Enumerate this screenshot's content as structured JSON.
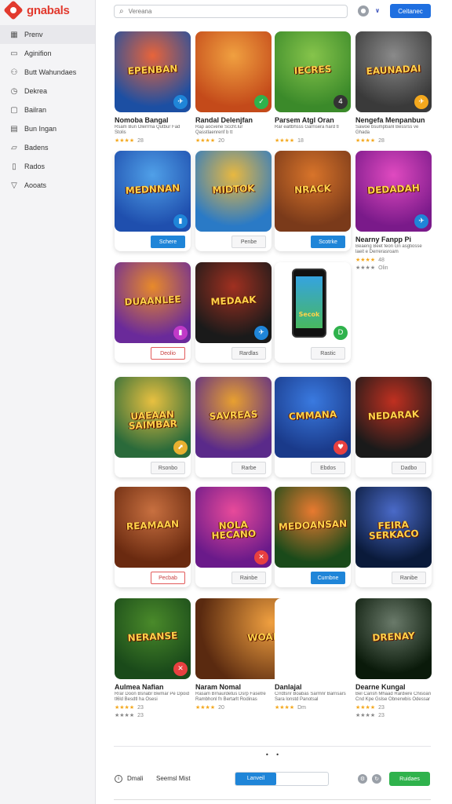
{
  "app": {
    "logo_text": "gnabals"
  },
  "sidebar": {
    "items": [
      {
        "label": "Prenv",
        "icon": "grid-icon"
      },
      {
        "label": "Aginifion",
        "icon": "rectangle-icon"
      },
      {
        "label": "Butt Wahundaes",
        "icon": "user-icon"
      },
      {
        "label": "Dekrea",
        "icon": "clock-icon"
      },
      {
        "label": "Bailran",
        "icon": "window-icon"
      },
      {
        "label": "Bun Ingan",
        "icon": "tag-icon"
      },
      {
        "label": "Badens",
        "icon": "folder-icon"
      },
      {
        "label": "Rados",
        "icon": "tablet-icon"
      },
      {
        "label": "Aooats",
        "icon": "triangle-icon"
      }
    ]
  },
  "header": {
    "search_placeholder": "Vereana",
    "action_label": "Ceitanec"
  },
  "cards": [
    {
      "thumb_text": "EPENBAN",
      "title": "Nomoba Bangal",
      "desc": "Rsam Bun Olerrma Qutbur Fad Stolis",
      "rating": "★★★★",
      "rating_num": "28",
      "badge": "✈",
      "badge_color": "#1f85d8",
      "colors": [
        "#1c4fa3",
        "#e8643a"
      ]
    },
    {
      "thumb_text": "",
      "title": "Randal Delenjfan",
      "desc": "Rap aocvene Sccht.lur Qasstlaenrenf b tt",
      "rating": "★★★★",
      "rating_num": "20",
      "badge": "✓",
      "badge_color": "#2fb24c",
      "colors": [
        "#c44a1a",
        "#f0a040"
      ]
    },
    {
      "thumb_text": "IECRES",
      "title": "Parsem Atgl Oran",
      "desc": "Rar ealtbhsss Garnsera hard tl",
      "rating": "★★★★",
      "rating_num": "18",
      "badge": "4",
      "badge_color": "#333333",
      "colors": [
        "#3b8a2a",
        "#86c44b"
      ]
    },
    {
      "thumb_text": "EAUNADAI",
      "title": "Nengefa Menpanbun",
      "desc": "Sawoe bsumpbanl Bessrss ve Ghada",
      "rating": "★★★★",
      "rating_num": "28",
      "badge": "✈",
      "badge_color": "#f4a81d",
      "colors": [
        "#3a3a3a",
        "#8a8a8a"
      ]
    },
    {
      "thumb_text": "MEDNNAN",
      "btn": "Schere",
      "btn_style": "blue",
      "badge": "▮",
      "badge_color": "#1f85d8",
      "colors": [
        "#1f4fae",
        "#50a0e8"
      ]
    },
    {
      "thumb_text": "MIDTOK",
      "btn": "Penbe",
      "btn_style": "",
      "colors": [
        "#2a7ac6",
        "#e8b840"
      ]
    },
    {
      "thumb_text": "NRACK",
      "btn": "Scotrke",
      "btn_style": "blue",
      "colors": [
        "#7a3a1a",
        "#d8742a"
      ]
    },
    {
      "thumb_text": "DEDADAH",
      "title": "Nearny Fanpp Pi",
      "desc": "Beaeng Beet feon Gn asgtiosse laeit e Derrerasroam",
      "rating": "★★★★",
      "rating_num": "48",
      "rating2": "★★★★",
      "rating2_num": "Olin",
      "badge": "✈",
      "badge_color": "#1f85d8",
      "colors": [
        "#7a1a8a",
        "#e04ac0"
      ]
    },
    {
      "thumb_text": "DUAANLEE",
      "btn": "Deolio",
      "btn_style": "red",
      "badge": "▮",
      "badge_color": "#c03ac8",
      "colors": [
        "#6a2a9a",
        "#e88a2a"
      ]
    },
    {
      "thumb_text": "MEDAAK",
      "btn": "Rardlas",
      "btn_style": "",
      "badge": "✈",
      "badge_color": "#1f85d8",
      "colors": [
        "#1a1a1a",
        "#a03020"
      ]
    },
    {
      "thumb_text": "",
      "btn": "Rastic",
      "btn_style": "",
      "phone_text": "Secok",
      "badge": "D",
      "badge_color": "#2fb24c"
    },
    {
      "empty": true
    },
    {
      "thumb_text": "UAEAAN SAIMBAR",
      "btn": "Rsonbo",
      "btn_style": "",
      "badge": "⬈",
      "badge_color": "#e8b030",
      "colors": [
        "#2a6a3a",
        "#e8c040"
      ]
    },
    {
      "thumb_text": "SAVREAS",
      "btn": "Rarbe",
      "btn_style": "",
      "colors": [
        "#5a2a8a",
        "#e8a030"
      ]
    },
    {
      "thumb_text": "CMMANA",
      "btn": "Ebdos",
      "btn_style": "",
      "badge": "♥",
      "badge_color": "#e84040",
      "colors": [
        "#1a3a8a",
        "#3a7ae0"
      ]
    },
    {
      "thumb_text": "NEDARAK",
      "btn": "Dadbo",
      "btn_style": "",
      "colors": [
        "#1a1a1a",
        "#c03020"
      ]
    },
    {
      "thumb_text": "REAMAAN",
      "btn": "Pecbab",
      "btn_style": "red",
      "colors": [
        "#6a2a10",
        "#c87040"
      ]
    },
    {
      "thumb_text": "NOLA HECANO",
      "btn": "Rainbe",
      "btn_style": "",
      "badge": "✕",
      "badge_color": "#e84040",
      "colors": [
        "#6a1a8a",
        "#e84a9a"
      ]
    },
    {
      "thumb_text": "MEDOANSAN",
      "btn": "Curnbne",
      "btn_style": "blue",
      "colors": [
        "#1a4a1a",
        "#e87a30"
      ]
    },
    {
      "thumb_text": "FEIRA SERKACO",
      "btn": "Ranibe",
      "btn_style": "",
      "colors": [
        "#0a1a3a",
        "#4a6ac8"
      ]
    },
    {
      "thumb_text": "NERANSE",
      "title": "Aulmea Nafian",
      "desc": "Rrar Doon Bsnabr Bwmar Pe Dpoid tl6ld Besdtl ha Osesi",
      "rating": "★★★★",
      "rating_num": "23",
      "rating2": "★★★★",
      "rating2_num": "23",
      "badge": "✕",
      "badge_color": "#e84040",
      "colors": [
        "#1a4a1a",
        "#4a8a2a"
      ]
    },
    {
      "thumb_text": "WOANCK",
      "title": "Naram Nomal",
      "desc": "Rasam Brnaurdetus Dsrp Fasetre Rambhonl fn Bertarlt Rodinas",
      "rating": "★★★★",
      "rating_num": "20",
      "wide": true,
      "badge": "✕",
      "badge_color": "#e84040",
      "colors": [
        "#5a2a10",
        "#f0a040"
      ]
    },
    {
      "thumb_text": "",
      "title": "Danlajal",
      "desc": "Crrdtsnr Boabas Sarmnr Barnsars Sara lonstd Panotsal",
      "rating": "★★★★",
      "rating_num": "Dm",
      "hidden_thumb": true
    },
    {
      "thumb_text": "DRENAY",
      "title": "Dearne Kungal",
      "desc": "Bel Cansh Mhaad Rardiere Chisoan Cnd Kpe Gslse Obnerwbis Odessar Blieetcaa",
      "rating": "★★★★",
      "rating_num": "23",
      "rating2": "★★★★",
      "rating2_num": "23",
      "colors": [
        "#0a1a0a",
        "#6a7a6a"
      ]
    }
  ],
  "pagination": {
    "dots": "• •"
  },
  "footer": {
    "label_1": "Dmali",
    "label_2": "Seemsl Mist",
    "toggle_on": "Lanveil",
    "button": "Ruidaes"
  }
}
